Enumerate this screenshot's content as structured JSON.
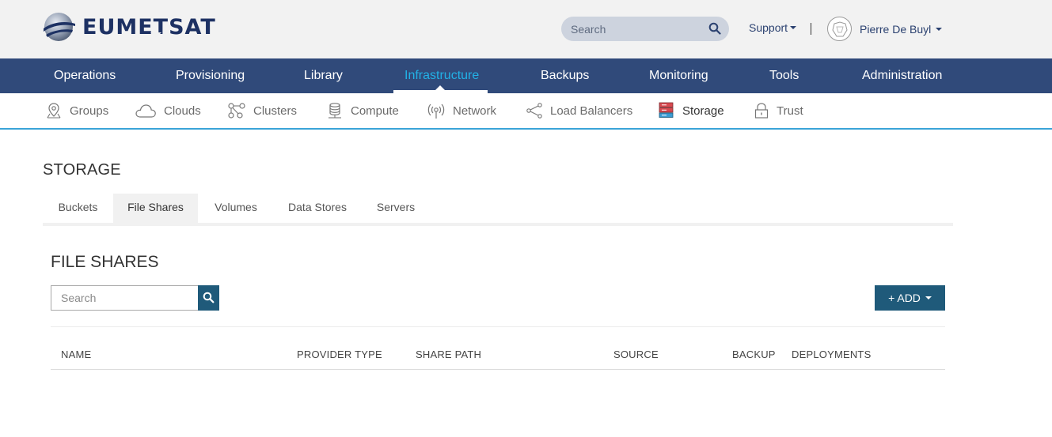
{
  "header": {
    "logo_text": "EUMETSAT",
    "search_placeholder": "Search",
    "support_label": "Support",
    "user_name": "Pierre De Buyl"
  },
  "main_nav": {
    "items": [
      {
        "label": "Operations",
        "active": false
      },
      {
        "label": "Provisioning",
        "active": false
      },
      {
        "label": "Library",
        "active": false
      },
      {
        "label": "Infrastructure",
        "active": true
      },
      {
        "label": "Backups",
        "active": false
      },
      {
        "label": "Monitoring",
        "active": false
      },
      {
        "label": "Tools",
        "active": false
      },
      {
        "label": "Administration",
        "active": false
      }
    ]
  },
  "sub_nav": {
    "items": [
      {
        "label": "Groups",
        "icon": "location-pin-icon"
      },
      {
        "label": "Clouds",
        "icon": "cloud-icon"
      },
      {
        "label": "Clusters",
        "icon": "cluster-icon"
      },
      {
        "label": "Compute",
        "icon": "database-icon"
      },
      {
        "label": "Network",
        "icon": "antenna-icon"
      },
      {
        "label": "Load Balancers",
        "icon": "share-icon"
      },
      {
        "label": "Storage",
        "icon": "storage-icon",
        "active": true
      },
      {
        "label": "Trust",
        "icon": "lock-icon"
      }
    ]
  },
  "page": {
    "title": "STORAGE",
    "tabs": [
      {
        "label": "Buckets",
        "active": false
      },
      {
        "label": "File Shares",
        "active": true
      },
      {
        "label": "Volumes",
        "active": false
      },
      {
        "label": "Data Stores",
        "active": false
      },
      {
        "label": "Servers",
        "active": false
      }
    ]
  },
  "section": {
    "title": "FILE SHARES",
    "search_placeholder": "Search",
    "add_label": "+ ADD",
    "columns": [
      "NAME",
      "PROVIDER TYPE",
      "SHARE PATH",
      "SOURCE",
      "BACKUP",
      "DEPLOYMENTS"
    ]
  },
  "colors": {
    "nav_bg": "#304a7a",
    "active_nav": "#22b1e6",
    "button_bg": "#1f5a7a",
    "storage_icon_red": "#d9484f",
    "storage_icon_blue": "#3a9bd2"
  }
}
